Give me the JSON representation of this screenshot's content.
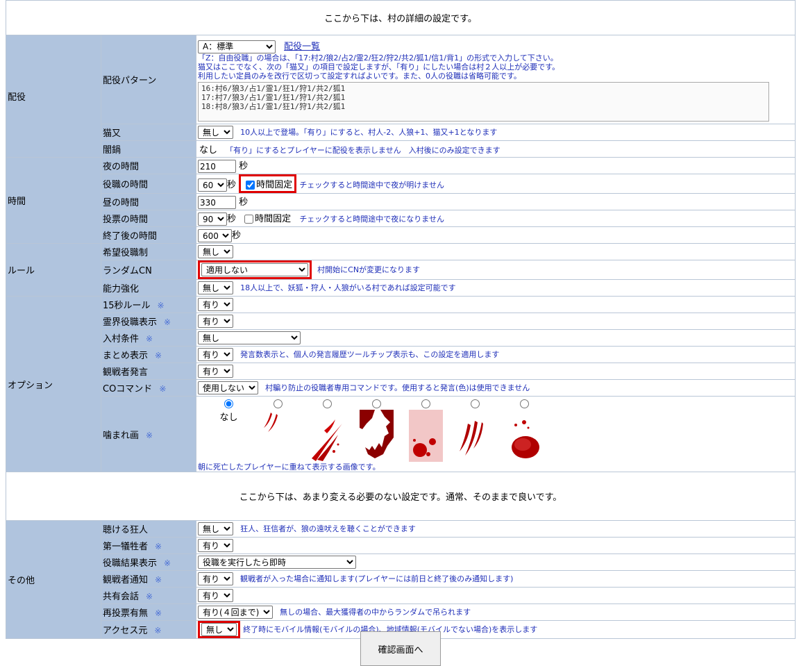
{
  "top_message": "ここから下は、村の詳細の設定です。",
  "mid_message": "ここから下は、あまり変える必要のない設定です。通常、そのままで良いです。",
  "sections": {
    "haiyaku": "配役",
    "jikan": "時間",
    "rule": "ルール",
    "option": "オプション",
    "other": "その他"
  },
  "haiyaku": {
    "pattern_label": "配役パターン",
    "pattern_select": "A：標準",
    "pattern_link": "配役一覧",
    "help1": "「Z：自由役職」の場合は、「17:村2/狼2/占2/霊2/狂2/狩2/共2/狐1/信1/背1」の形式で入力して下さい。",
    "help2": "猫又はここでなく、次の「猫又」の項目で設定しますが、「有り」にしたい場合は村２人以上が必要です。",
    "help3": "利用したい定員のみを改行で区切って設定すればよいです。また、0人の役職は省略可能です。",
    "textarea": "16:村6/狼3/占1/霊1/狂1/狩1/共2/狐1\n17:村7/狼3/占1/霊1/狂1/狩1/共2/狐1\n18:村8/狼3/占1/霊1/狂1/狩1/共2/狐1",
    "nekomata_label": "猫又",
    "nekomata_value": "無し",
    "nekomata_note": "10人以上で登場。「有り」にすると、村人-2、人狼+1、猫又+1となります",
    "yaminabe_label": "闇鍋",
    "yaminabe_value": "なし",
    "yaminabe_note": "「有り」にするとプレイヤーに配役を表示しません　入村後にのみ設定できます"
  },
  "jikan": {
    "night_label": "夜の時間",
    "night_value": "210",
    "role_label": "役職の時間",
    "role_value": "60",
    "role_fixed": "時間固定",
    "role_note": "チェックすると時間途中で夜が明けません",
    "day_label": "昼の時間",
    "day_value": "330",
    "vote_label": "投票の時間",
    "vote_value": "90",
    "vote_fixed": "時間固定",
    "vote_note": "チェックすると時間途中で夜になりません",
    "end_label": "終了後の時間",
    "end_value": "600",
    "unit": "秒"
  },
  "rule": {
    "kibou_label": "希望役職制",
    "kibou_value": "無し",
    "random_label": "ランダムCN",
    "random_value": "適用しない",
    "random_note": "村開始にCNが変更になります",
    "nouryoku_label": "能力強化",
    "nouryoku_value": "無し",
    "nouryoku_note": "18人以上で、妖狐・狩人・人狼がいる村であれば設定可能です"
  },
  "option": {
    "rule15_label": "15秒ルール",
    "rule15_value": "有り",
    "reikai_label": "霊界役職表示",
    "reikai_value": "有り",
    "nyuuson_label": "入村条件",
    "nyuuson_value": "無し",
    "matome_label": "まとめ表示",
    "matome_value": "有り",
    "matome_note": "発言数表示と、個人の発言履歴ツールチップ表示も、この設定を適用します",
    "kansen_label": "観戦者発言",
    "kansen_value": "有り",
    "co_label": "COコマンド",
    "co_value": "使用しない",
    "co_note": "村騙り防止の役職者専用コマンドです。使用すると発言(色)は使用できません",
    "kamare_label": "噛まれ画",
    "kamare_none": "なし",
    "kamare_note": "朝に死亡したプレイヤーに重ねて表示する画像です。",
    "asterisk": "※"
  },
  "other": {
    "kikeru_label": "聴ける狂人",
    "kikeru_value": "無し",
    "kikeru_note": "狂人、狂信者が、狼の遠吠えを聴くことができます",
    "dai1_label": "第一犠牲者",
    "dai1_value": "有り",
    "kekka_label": "役職結果表示",
    "kekka_value": "役職を実行したら即時",
    "tsuuchi_label": "観戦者通知",
    "tsuuchi_value": "有り",
    "tsuuchi_note": "観戦者が入った場合に通知します(プレイヤーには前日と終了後のみ通知します)",
    "kyouyuu_label": "共有会話",
    "kyouyuu_value": "有り",
    "saitouhyou_label": "再投票有無",
    "saitouhyou_value": "有り(４回まで)",
    "saitouhyou_note": "無しの場合、最大獲得者の中からランダムで吊られます",
    "access_label": "アクセス元",
    "access_value": "無し",
    "access_note": "終了時にモバイル情報(モバイルの場合)、地域情報(モバイルでない場合)を表示します"
  },
  "confirm_button": "確認画面へ",
  "colors": {
    "label_bg": "#b0c4de",
    "note_blue": "#1f2fb8",
    "highlight": "#e00000"
  }
}
